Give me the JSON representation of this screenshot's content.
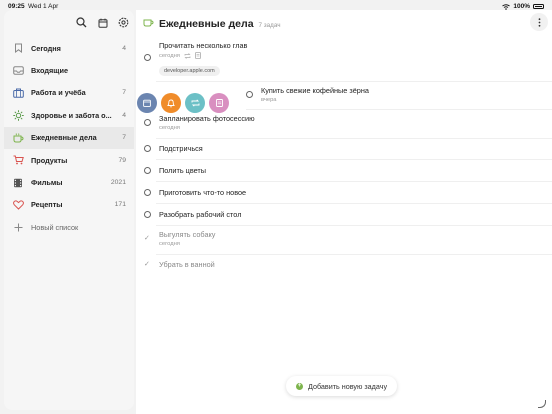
{
  "status": {
    "time": "09:25",
    "date": "Wed 1 Apr",
    "battery": "100%"
  },
  "sidebar": {
    "items": [
      {
        "label": "Сегодня",
        "count": "4",
        "icon": "bookmark-icon"
      },
      {
        "label": "Входящие",
        "count": "",
        "icon": "inbox-icon"
      },
      {
        "label": "Работа и учёба",
        "count": "7",
        "icon": "briefcase-icon"
      },
      {
        "label": "Здоровье и забота о...",
        "count": "4",
        "icon": "sun-icon"
      },
      {
        "label": "Ежедневные дела",
        "count": "7",
        "icon": "cup-icon"
      },
      {
        "label": "Продукты",
        "count": "79",
        "icon": "cart-icon"
      },
      {
        "label": "Фильмы",
        "count": "2021",
        "icon": "film-icon"
      },
      {
        "label": "Рецепты",
        "count": "171",
        "icon": "heart-icon"
      }
    ],
    "new_list": "Новый список"
  },
  "main": {
    "title": "Ежедневные дела",
    "count": "7 задач",
    "tasks": [
      {
        "title": "Прочитать несколько глав",
        "sub": "сегодня",
        "url": "developer.apple.com"
      },
      {
        "title": "Купить свежие кофейные зёрна",
        "sub": "вчера"
      },
      {
        "title": "Запланировать фотосессию",
        "sub": "сегодня"
      },
      {
        "title": "Подстричься"
      },
      {
        "title": "Полить цветы"
      },
      {
        "title": "Приготовить что-то новое"
      },
      {
        "title": "Разобрать рабочий стол"
      },
      {
        "title": "Выгулять собаку",
        "sub": "сегодня"
      },
      {
        "title": "Убрать в ванной"
      }
    ],
    "add_task": "Добавить новую задачу"
  },
  "colors": {
    "accent_green": "#7db44c",
    "swipe_calendar": "#6b85b0",
    "swipe_bell": "#f08c2a",
    "swipe_repeat": "#6cc0c6",
    "swipe_note": "#d98fc0"
  }
}
